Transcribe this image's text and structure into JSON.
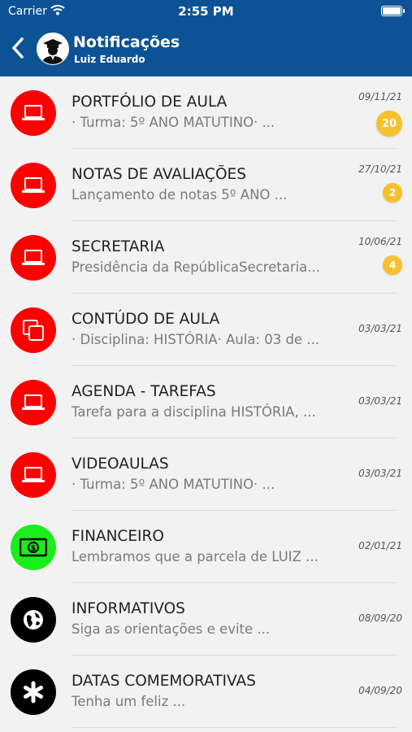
{
  "status_bar": {
    "carrier": "Carrier",
    "time": "2:55 PM"
  },
  "header": {
    "title": "Notificações",
    "subtitle": "Luiz Eduardo"
  },
  "colors": {
    "header_bg": "#0d5295",
    "red": "#ff0000",
    "green": "#19ee19",
    "black": "#000000",
    "badge": "#f7c12e"
  },
  "items": [
    {
      "title": "PORTFÓLIO DE AULA",
      "subtitle": "· Turma: 5º ANO MATUTINO· ...",
      "date": "09/11/21",
      "badge": "20",
      "icon": "laptop-icon",
      "color": "red"
    },
    {
      "title": "NOTAS DE AVALIAÇÕES",
      "subtitle": "Lançamento de notas 5º ANO ...",
      "date": "27/10/21",
      "badge": "2",
      "icon": "laptop-icon",
      "color": "red"
    },
    {
      "title": "SECRETARIA",
      "subtitle": "Presidência da RepúblicaSecretaria...",
      "date": "10/06/21",
      "badge": "4",
      "icon": "laptop-icon",
      "color": "red"
    },
    {
      "title": "CONTÚDO DE AULA",
      "subtitle": "· Disciplina: HISTÓRIA· Aula: 03 de ...",
      "date": "03/03/21",
      "badge": null,
      "icon": "copy-icon",
      "color": "red"
    },
    {
      "title": "AGENDA - TAREFAS",
      "subtitle": "Tarefa para a disciplina HISTÓRIA, ...",
      "date": "03/03/21",
      "badge": null,
      "icon": "laptop-icon",
      "color": "red"
    },
    {
      "title": "VIDEOAULAS",
      "subtitle": "· Turma: 5º ANO MATUTINO· ...",
      "date": "03/03/21",
      "badge": null,
      "icon": "laptop-icon",
      "color": "red"
    },
    {
      "title": "FINANCEIRO",
      "subtitle": "Lembramos que a parcela de LUIZ ...",
      "date": "02/01/21",
      "badge": null,
      "icon": "money-icon",
      "color": "green"
    },
    {
      "title": "INFORMATIVOS",
      "subtitle": "Siga as orientações e evite ...",
      "date": "08/09/20",
      "badge": null,
      "icon": "globe-icon",
      "color": "black"
    },
    {
      "title": "DATAS COMEMORATIVAS",
      "subtitle": "Tenha um feliz ...",
      "date": "04/09/20",
      "badge": null,
      "icon": "asterisk-icon",
      "color": "black"
    }
  ]
}
